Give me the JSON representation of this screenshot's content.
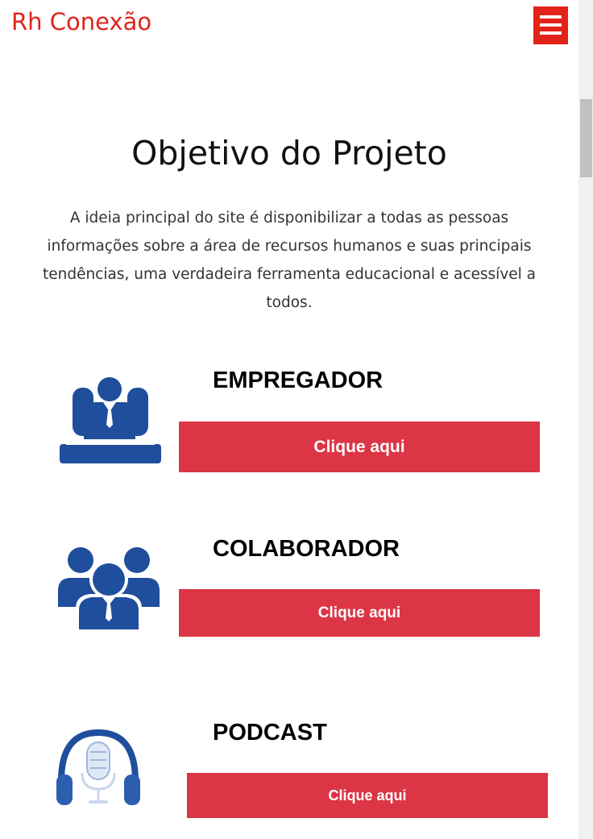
{
  "header": {
    "brand": "Rh Conexão",
    "menu_icon": "hamburger-menu-icon",
    "accent_color": "#e2231a"
  },
  "objective": {
    "title": "Objetivo do Projeto",
    "description": "A ideia principal do site é disponibilizar a todas as pessoas informações sobre a área de recursos humanos e suas principais tendências, uma verdadeira ferramenta educacional e acessível a todos."
  },
  "cards": [
    {
      "title": "EMPREGADOR",
      "button_label": "Clique aqui",
      "icon": "employer-icon"
    },
    {
      "title": "COLABORADOR",
      "button_label": "Clique aqui",
      "icon": "team-icon"
    },
    {
      "title": "PODCAST",
      "button_label": "Clique aqui",
      "icon": "podcast-microphone-icon"
    }
  ],
  "colors": {
    "button_bg": "#dc3545",
    "icon_blue": "#1f4e9c"
  }
}
